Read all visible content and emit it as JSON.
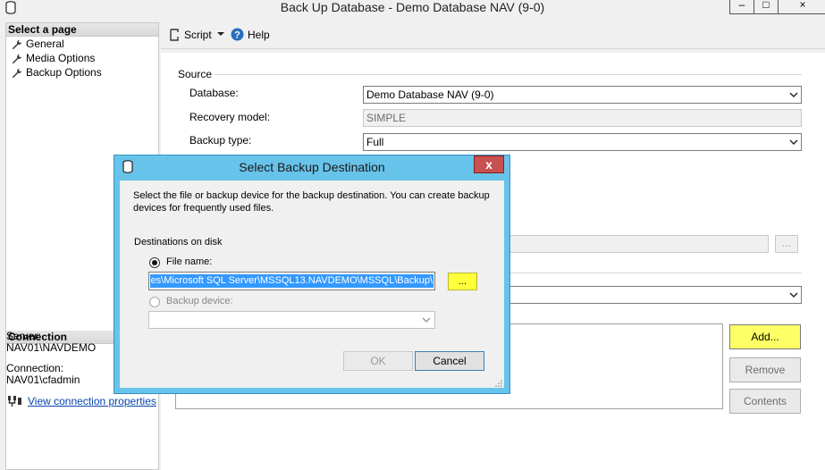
{
  "window": {
    "title": "Back Up Database - Demo Database NAV (9-0)",
    "min_label": "–",
    "max_label": "□",
    "close_label": "×"
  },
  "left_panel": {
    "select_page_header": "Select a page",
    "pages": [
      {
        "label": "General",
        "icon": "wrench-icon"
      },
      {
        "label": "Media Options",
        "icon": "wrench-icon"
      },
      {
        "label": "Backup Options",
        "icon": "wrench-icon"
      }
    ],
    "connection_header": "Connection",
    "server_label": "Server:",
    "server_value": "NAV01\\NAVDEMO",
    "connection_label": "Connection:",
    "connection_value": "NAV01\\cfadmin",
    "view_connection_link": "View connection properties"
  },
  "toolbar": {
    "script_label": "Script",
    "help_label": "Help"
  },
  "form": {
    "source_label": "Source",
    "database_label": "Database:",
    "database_value": "Demo Database NAV (9-0)",
    "recovery_model_label": "Recovery model:",
    "recovery_model_value": "SIMPLE",
    "backup_type_label": "Backup type:",
    "backup_type_value": "Full",
    "browse_label": "...",
    "add_label": "Add...",
    "remove_label": "Remove",
    "contents_label": "Contents"
  },
  "dialog": {
    "title": "Select Backup Destination",
    "close_label": "x",
    "description": "Select the file or backup device for the backup destination. You can create backup devices for frequently used files.",
    "destinations_label": "Destinations on disk",
    "file_name_label": "File name:",
    "file_name_value": "es\\Microsoft SQL Server\\MSSQL13.NAVDEMO\\MSSQL\\Backup\\",
    "file_browse_label": "...",
    "backup_device_label": "Backup device:",
    "ok_label": "OK",
    "cancel_label": "Cancel"
  },
  "colors": {
    "dialog_frame": "#68c3ea",
    "highlight_yellow": "#ffff3a",
    "selection_blue": "#3399ff",
    "close_red": "#c75050"
  }
}
